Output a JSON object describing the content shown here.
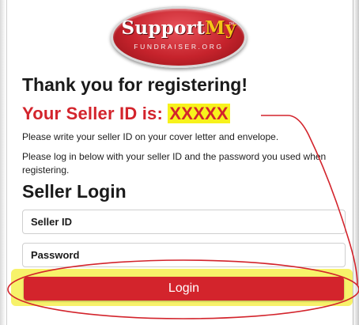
{
  "logo": {
    "word1": "Support",
    "word2": "My",
    "trademark": "™",
    "subtitle": "FUNDRAISER.ORG"
  },
  "page": {
    "heading": "Thank you for registering!",
    "seller_id_label": "Your Seller ID is: ",
    "seller_id_value": "XXXXX",
    "instruction_1": "Please write your seller ID on your cover letter and envelope.",
    "instruction_2": "Please log in below with your seller ID and the password you used when registering."
  },
  "login": {
    "heading": "Seller Login",
    "seller_id_placeholder": "Seller ID",
    "password_placeholder": "Password",
    "button_label": "Login"
  },
  "colors": {
    "brand_red": "#d3242c",
    "highlight_yellow": "#f7f21c",
    "logo_gold": "#f5c518"
  }
}
